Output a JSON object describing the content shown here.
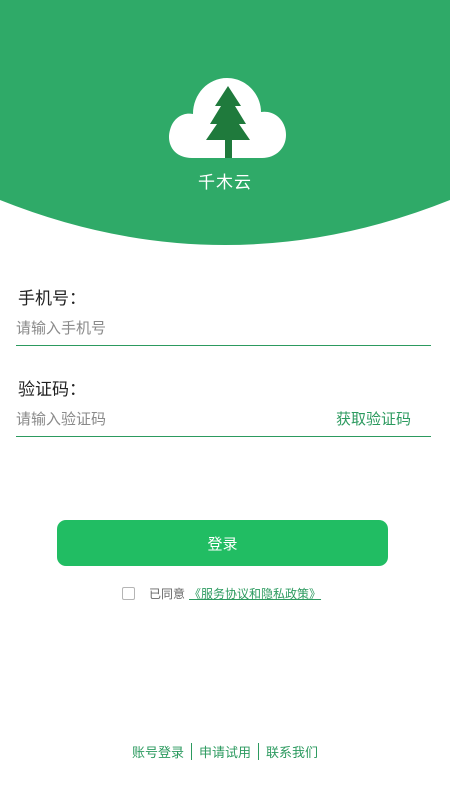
{
  "app": {
    "name": "千木云"
  },
  "colors": {
    "brand_green": "#2faa68",
    "button_green": "#21bd63",
    "link_green": "#2c9a5f",
    "tree_green": "#1f7a3c"
  },
  "form": {
    "phone": {
      "label": "手机号：",
      "placeholder": "请输入手机号",
      "value": ""
    },
    "code": {
      "label": "验证码：",
      "placeholder": "请输入验证码",
      "value": "",
      "get_code_label": "获取验证码"
    }
  },
  "login_button": {
    "label": "登录"
  },
  "agreement": {
    "checked": false,
    "text": "已同意",
    "link_label": "《服务协议和隐私政策》"
  },
  "footer": {
    "links": [
      {
        "label": "账号登录"
      },
      {
        "label": "申请试用"
      },
      {
        "label": "联系我们"
      }
    ]
  },
  "icons": {
    "logo": "cloud-tree-logo-icon"
  }
}
